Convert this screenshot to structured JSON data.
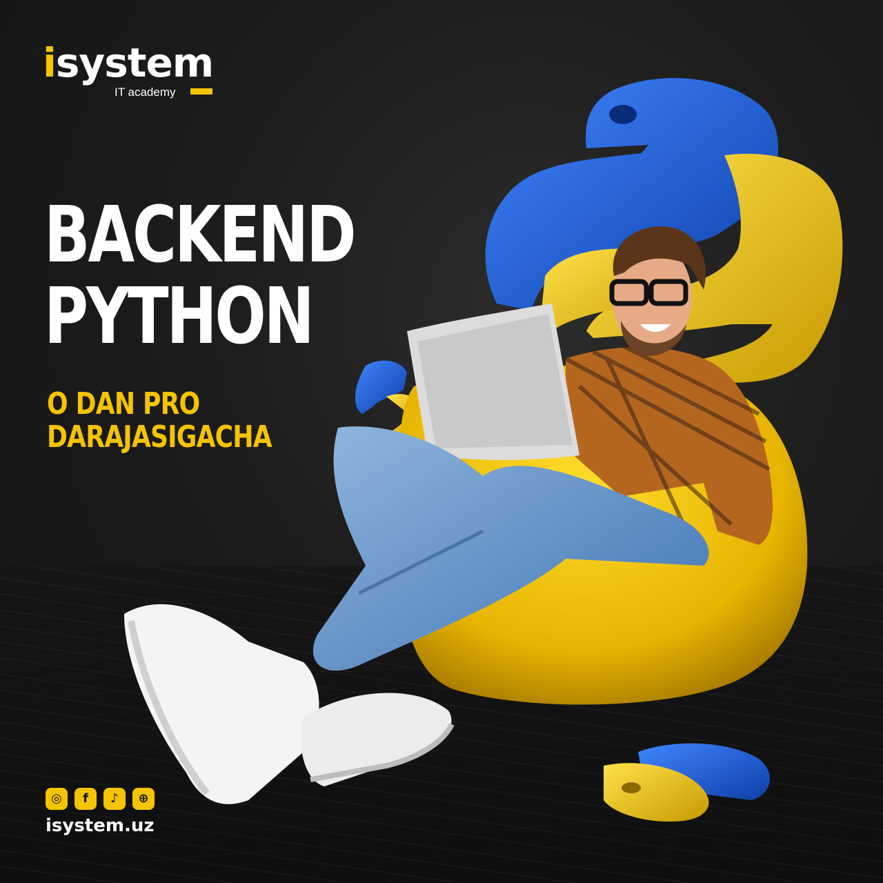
{
  "brand": {
    "name_initial": "i",
    "name_rest": "system",
    "tagline": "IT academy",
    "accent_color": "#f5c400"
  },
  "headline": {
    "line1": "BACKEND",
    "line2": "PYTHON"
  },
  "subheadline": {
    "line1": "O DAN PRO",
    "line2": "DARAJASIGACHA"
  },
  "social": {
    "icons": [
      "instagram-icon",
      "facebook-icon",
      "tiktok-icon",
      "globe-icon"
    ],
    "glyphs": [
      "◎",
      "f",
      "♪",
      "⊕"
    ]
  },
  "website": "isystem.uz",
  "colors": {
    "background": "#1c1c1c",
    "python_blue": "#1f5fd6",
    "python_yellow": "#f2c411"
  }
}
